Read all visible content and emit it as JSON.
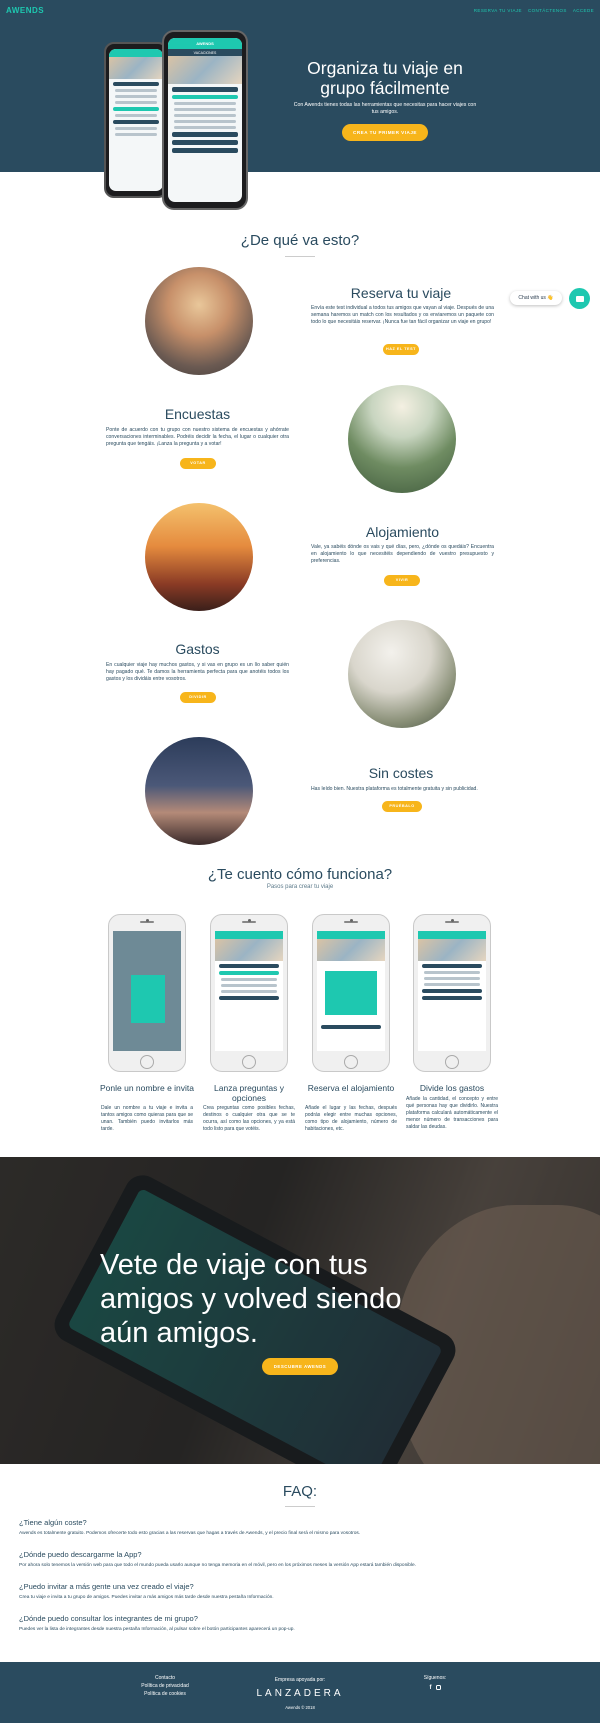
{
  "nav": {
    "logo": "AWENDS",
    "links": [
      "RESERVA TU VIAJE",
      "CONTÁCTENOS",
      "ACCEDE"
    ]
  },
  "hero": {
    "title": "Organiza tu viaje en grupo fácilmente",
    "subtitle": "Con Awends tienes todas las herramientas que necesitas para hacer viajes con tus amigos.",
    "button": "CREA TU PRIMER VIAJE",
    "phone_header": "AWENDS",
    "phone_tab": "VACACIONES"
  },
  "about": {
    "title": "¿De qué va esto?",
    "features": [
      {
        "title": "Reserva tu viaje",
        "text": "Envía este test individual a todos tus amigos que vayan al viaje. Después de una semana haremos un match con los resultados y os enviaremos un paquete con todo lo que necesitáis reservar. ¡Nunca fue tan fácil organizar un viaje en grupo!",
        "button": "HAZ EL TEST"
      },
      {
        "title": "Encuestas",
        "text": "Ponte de acuerdo con tu grupo con nuestro sistema de encuestas y ahórrate conversaciones interminables. Podréis decidir la fecha, el lugar o cualquier otra pregunta que tengáis. ¡Lanza la pregunta y a votar!",
        "button": "VOTAR"
      },
      {
        "title": "Alojamiento",
        "text": "Vale, ya sabéis dónde os vais y qué días, pero, ¿dónde os quedáis? Encuentra en alojamiento lo que necesitéis dependiendo de vuestro presupuesto y preferencias.",
        "button": "VIVIR"
      },
      {
        "title": "Gastos",
        "text": "En cualquier viaje hay muchos gastos, y si vas en grupo es un lío saber quién hay pagado qué. Te damos la herramienta perfecta para que anotéis todos los gastos y los dividáis entre vosotros.",
        "button": "DIVIDIR"
      },
      {
        "title": "Sin costes",
        "text": "Has leído bien. Nuestra plataforma es totalmente gratuita y sin publicidad.",
        "button": "PRUÉBALO"
      }
    ]
  },
  "chat": {
    "label": "Chat with us 👋"
  },
  "how": {
    "title": "¿Te cuento cómo funciona?",
    "subtitle": "Pasos para crear tu viaje",
    "steps": [
      {
        "title": "Ponle un nombre e invita",
        "text": "Dale un nombre a tu viaje e invita a tantos amigos como quieras para que se unan. También puedo invitarlos más tarde."
      },
      {
        "title": "Lanza preguntas y opciones",
        "text": "Crea preguntas como posibles fechas, destinos o cualquier otra que se te ocurra, así como las opciones, y ya está todo listo para que votéis."
      },
      {
        "title": "Reserva el alojamiento",
        "text": "Añade el lugar y las fechas, después podrás elegir entre muchas opciones, como tipo de alojamiento, número de habitaciones, etc."
      },
      {
        "title": "Divide los gastos",
        "text": "Añade la cantidad, el concepto y entre qué personas hay que dividirlo. Nuestra plataforma calculará automáticamente el menor número de transacciones para saldar las deudas."
      }
    ]
  },
  "banner": {
    "title": "Vete de viaje con tus amigos y volved siendo aún amigos.",
    "button": "DESCUBRE AWENDS"
  },
  "faq": {
    "title": "FAQ:",
    "items": [
      {
        "q": "¿Tiene algún coste?",
        "a": "Awends es totalmente gratuito. Podemos ofrecerte todo esto gracias a las reservas que hagas a través de Awends, y el precio final será el mismo para vosotros."
      },
      {
        "q": "¿Dónde puedo descargarme la App?",
        "a": "Por ahora solo tenemos la versión web para que todo el mundo pueda usarlo aunque no tenga memoria en el móvil, pero en los próximos meses la versión App estará también disponible."
      },
      {
        "q": "¿Puedo invitar a más gente una vez creado el viaje?",
        "a": "Crea tu viaje e invita a tu grupo de amigos. Puedes invitar a más amigos más tarde desde nuestra pestaña Información."
      },
      {
        "q": "¿Dónde puedo consultar los integrantes de mi grupo?",
        "a": "Puedes ver la lista de integrantes desde nuestra pestaña Información, al pulsar sobre el botón participantes aparecerá un pop-up."
      }
    ]
  },
  "footer": {
    "links": [
      "Contacto",
      "Política de privacidad",
      "Política de cookies"
    ],
    "supported": "Empresa apoyada por:",
    "partner": "LANZADERA",
    "copyright": "Awends © 2018",
    "follow": "Síguenos:"
  },
  "colors": {
    "navy": "#2a4b5f",
    "teal": "#1ec8b0",
    "yellow": "#f7b51b"
  }
}
